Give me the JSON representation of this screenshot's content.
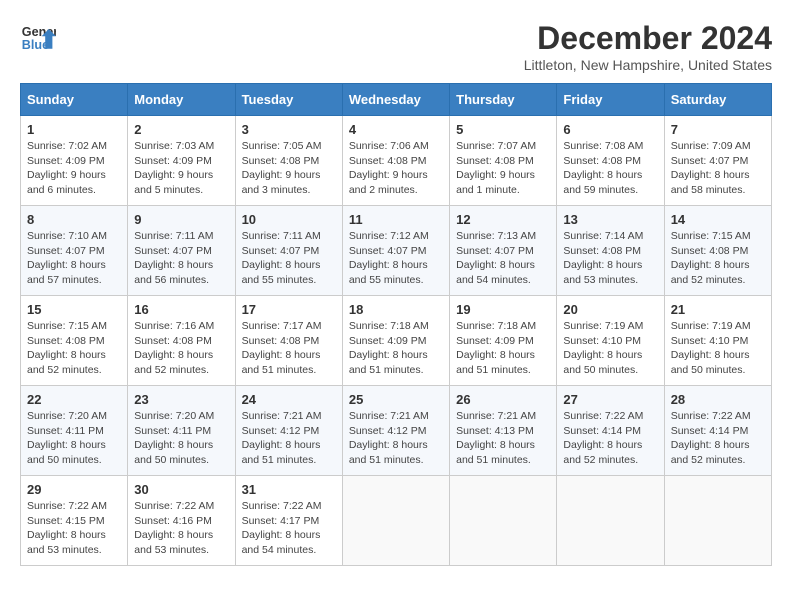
{
  "logo": {
    "line1": "General",
    "line2": "Blue",
    "arrow_color": "#3a7fc1"
  },
  "title": "December 2024",
  "location": "Littleton, New Hampshire, United States",
  "weekdays": [
    "Sunday",
    "Monday",
    "Tuesday",
    "Wednesday",
    "Thursday",
    "Friday",
    "Saturday"
  ],
  "weeks": [
    [
      {
        "day": "1",
        "info": "Sunrise: 7:02 AM\nSunset: 4:09 PM\nDaylight: 9 hours\nand 6 minutes."
      },
      {
        "day": "2",
        "info": "Sunrise: 7:03 AM\nSunset: 4:09 PM\nDaylight: 9 hours\nand 5 minutes."
      },
      {
        "day": "3",
        "info": "Sunrise: 7:05 AM\nSunset: 4:08 PM\nDaylight: 9 hours\nand 3 minutes."
      },
      {
        "day": "4",
        "info": "Sunrise: 7:06 AM\nSunset: 4:08 PM\nDaylight: 9 hours\nand 2 minutes."
      },
      {
        "day": "5",
        "info": "Sunrise: 7:07 AM\nSunset: 4:08 PM\nDaylight: 9 hours\nand 1 minute."
      },
      {
        "day": "6",
        "info": "Sunrise: 7:08 AM\nSunset: 4:08 PM\nDaylight: 8 hours\nand 59 minutes."
      },
      {
        "day": "7",
        "info": "Sunrise: 7:09 AM\nSunset: 4:07 PM\nDaylight: 8 hours\nand 58 minutes."
      }
    ],
    [
      {
        "day": "8",
        "info": "Sunrise: 7:10 AM\nSunset: 4:07 PM\nDaylight: 8 hours\nand 57 minutes."
      },
      {
        "day": "9",
        "info": "Sunrise: 7:11 AM\nSunset: 4:07 PM\nDaylight: 8 hours\nand 56 minutes."
      },
      {
        "day": "10",
        "info": "Sunrise: 7:11 AM\nSunset: 4:07 PM\nDaylight: 8 hours\nand 55 minutes."
      },
      {
        "day": "11",
        "info": "Sunrise: 7:12 AM\nSunset: 4:07 PM\nDaylight: 8 hours\nand 55 minutes."
      },
      {
        "day": "12",
        "info": "Sunrise: 7:13 AM\nSunset: 4:07 PM\nDaylight: 8 hours\nand 54 minutes."
      },
      {
        "day": "13",
        "info": "Sunrise: 7:14 AM\nSunset: 4:08 PM\nDaylight: 8 hours\nand 53 minutes."
      },
      {
        "day": "14",
        "info": "Sunrise: 7:15 AM\nSunset: 4:08 PM\nDaylight: 8 hours\nand 52 minutes."
      }
    ],
    [
      {
        "day": "15",
        "info": "Sunrise: 7:15 AM\nSunset: 4:08 PM\nDaylight: 8 hours\nand 52 minutes."
      },
      {
        "day": "16",
        "info": "Sunrise: 7:16 AM\nSunset: 4:08 PM\nDaylight: 8 hours\nand 52 minutes."
      },
      {
        "day": "17",
        "info": "Sunrise: 7:17 AM\nSunset: 4:08 PM\nDaylight: 8 hours\nand 51 minutes."
      },
      {
        "day": "18",
        "info": "Sunrise: 7:18 AM\nSunset: 4:09 PM\nDaylight: 8 hours\nand 51 minutes."
      },
      {
        "day": "19",
        "info": "Sunrise: 7:18 AM\nSunset: 4:09 PM\nDaylight: 8 hours\nand 51 minutes."
      },
      {
        "day": "20",
        "info": "Sunrise: 7:19 AM\nSunset: 4:10 PM\nDaylight: 8 hours\nand 50 minutes."
      },
      {
        "day": "21",
        "info": "Sunrise: 7:19 AM\nSunset: 4:10 PM\nDaylight: 8 hours\nand 50 minutes."
      }
    ],
    [
      {
        "day": "22",
        "info": "Sunrise: 7:20 AM\nSunset: 4:11 PM\nDaylight: 8 hours\nand 50 minutes."
      },
      {
        "day": "23",
        "info": "Sunrise: 7:20 AM\nSunset: 4:11 PM\nDaylight: 8 hours\nand 50 minutes."
      },
      {
        "day": "24",
        "info": "Sunrise: 7:21 AM\nSunset: 4:12 PM\nDaylight: 8 hours\nand 51 minutes."
      },
      {
        "day": "25",
        "info": "Sunrise: 7:21 AM\nSunset: 4:12 PM\nDaylight: 8 hours\nand 51 minutes."
      },
      {
        "day": "26",
        "info": "Sunrise: 7:21 AM\nSunset: 4:13 PM\nDaylight: 8 hours\nand 51 minutes."
      },
      {
        "day": "27",
        "info": "Sunrise: 7:22 AM\nSunset: 4:14 PM\nDaylight: 8 hours\nand 52 minutes."
      },
      {
        "day": "28",
        "info": "Sunrise: 7:22 AM\nSunset: 4:14 PM\nDaylight: 8 hours\nand 52 minutes."
      }
    ],
    [
      {
        "day": "29",
        "info": "Sunrise: 7:22 AM\nSunset: 4:15 PM\nDaylight: 8 hours\nand 53 minutes."
      },
      {
        "day": "30",
        "info": "Sunrise: 7:22 AM\nSunset: 4:16 PM\nDaylight: 8 hours\nand 53 minutes."
      },
      {
        "day": "31",
        "info": "Sunrise: 7:22 AM\nSunset: 4:17 PM\nDaylight: 8 hours\nand 54 minutes."
      },
      {
        "day": "",
        "info": ""
      },
      {
        "day": "",
        "info": ""
      },
      {
        "day": "",
        "info": ""
      },
      {
        "day": "",
        "info": ""
      }
    ]
  ]
}
